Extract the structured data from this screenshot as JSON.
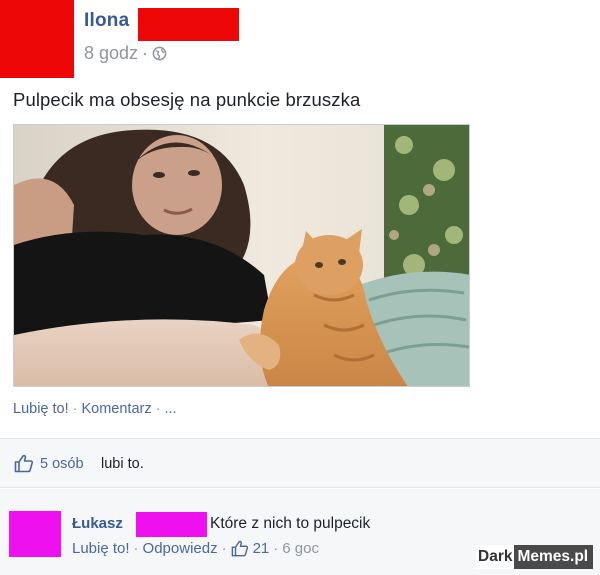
{
  "post": {
    "author": "Ilona",
    "time": "8 godz",
    "text": "Pulpecik ma obsesję na punkcie brzuszka",
    "actions": {
      "like": "Lubię to!",
      "comment": "Komentarz",
      "more": "..."
    }
  },
  "likes": {
    "count": "5 osób",
    "suffix": "lubi to."
  },
  "comment": {
    "author": "Łukasz",
    "text": "Które z nich to pulpecik",
    "like": "Lubię to!",
    "reply": "Odpowiedz",
    "like_count": "21",
    "time": "6 goc"
  },
  "watermark": {
    "part1": "Dark",
    "part2": "Memes.pl"
  },
  "colors": {
    "link": "#3b5998",
    "redaction_red": "#ee0707",
    "redaction_magenta": "#ee10ee"
  }
}
